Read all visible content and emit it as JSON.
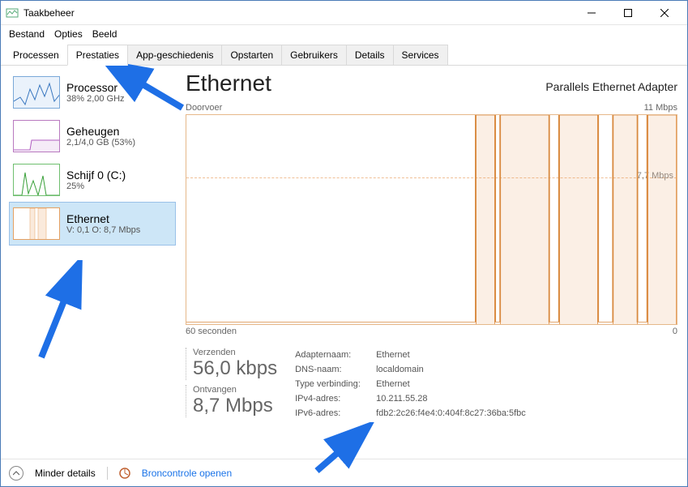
{
  "window": {
    "title": "Taakbeheer"
  },
  "menu": {
    "file": "Bestand",
    "options": "Opties",
    "view": "Beeld"
  },
  "tabs": {
    "processen": "Processen",
    "prestaties": "Prestaties",
    "appgeschiedenis": "App-geschiedenis",
    "opstarten": "Opstarten",
    "gebruikers": "Gebruikers",
    "details": "Details",
    "services": "Services"
  },
  "sidebar": {
    "cpu": {
      "title": "Processor",
      "sub": "38%  2,00 GHz"
    },
    "mem": {
      "title": "Geheugen",
      "sub": "2,1/4,0 GB (53%)"
    },
    "disk": {
      "title": "Schijf 0 (C:)",
      "sub": "25%"
    },
    "eth": {
      "title": "Ethernet",
      "sub": "V: 0,1 O: 8,7 Mbps"
    }
  },
  "main": {
    "title": "Ethernet",
    "adapter": "Parallels Ethernet Adapter",
    "chart_top_left": "Doorvoer",
    "chart_top_right": "11 Mbps",
    "chart_mid_label": "7,7 Mbps",
    "chart_bottom_left": "60 seconden",
    "chart_bottom_right": "0",
    "send_label": "Verzenden",
    "send_value": "56,0 kbps",
    "recv_label": "Ontvangen",
    "recv_value": "8,7 Mbps",
    "details": {
      "adapter_k": "Adapternaam:",
      "adapter_v": "Ethernet",
      "dns_k": "DNS-naam:",
      "dns_v": "localdomain",
      "type_k": "Type verbinding:",
      "type_v": "Ethernet",
      "ipv4_k": "IPv4-adres:",
      "ipv4_v": "10.211.55.28",
      "ipv6_k": "IPv6-adres:",
      "ipv6_v": "fdb2:2c26:f4e4:0:404f:8c27:36ba:5fbc"
    }
  },
  "footer": {
    "less": "Minder details",
    "bron": "Broncontrole openen"
  },
  "chart_data": {
    "type": "area",
    "title": "Doorvoer",
    "ylabel": "Mbps",
    "ylim": [
      0,
      11
    ],
    "x_range_seconds": 60,
    "reference_lines": [
      {
        "value": 7.7,
        "label": "7,7 Mbps"
      }
    ],
    "series": [
      {
        "name": "Ontvangen",
        "approx_values": [
          0,
          0,
          0,
          0,
          0,
          0,
          0,
          0,
          0,
          0,
          0,
          0,
          0,
          0,
          0,
          0,
          0,
          0,
          0,
          0,
          0,
          0,
          0,
          0,
          0,
          0,
          0,
          0,
          0,
          0,
          0,
          0,
          0,
          0,
          0,
          0,
          11,
          11,
          0,
          11,
          11,
          11,
          11,
          11,
          0,
          11,
          11,
          11,
          11,
          0,
          0,
          0,
          11,
          11,
          11,
          11,
          0,
          11,
          11,
          11
        ]
      },
      {
        "name": "Verzenden",
        "approx_values": [
          0,
          0,
          0,
          0,
          0,
          0,
          0,
          0,
          0,
          0,
          0,
          0,
          0,
          0,
          0,
          0,
          0,
          0,
          0,
          0,
          0,
          0,
          0,
          0,
          0,
          0,
          0,
          0,
          0,
          0,
          0,
          0,
          0,
          0,
          0,
          0,
          0.1,
          0.1,
          0,
          0.1,
          0.1,
          0.1,
          0.1,
          0.1,
          0,
          0.1,
          0.1,
          0.1,
          0.1,
          0,
          0,
          0,
          0.1,
          0.1,
          0.1,
          0.1,
          0,
          0.1,
          0.1,
          0.1
        ]
      }
    ]
  }
}
